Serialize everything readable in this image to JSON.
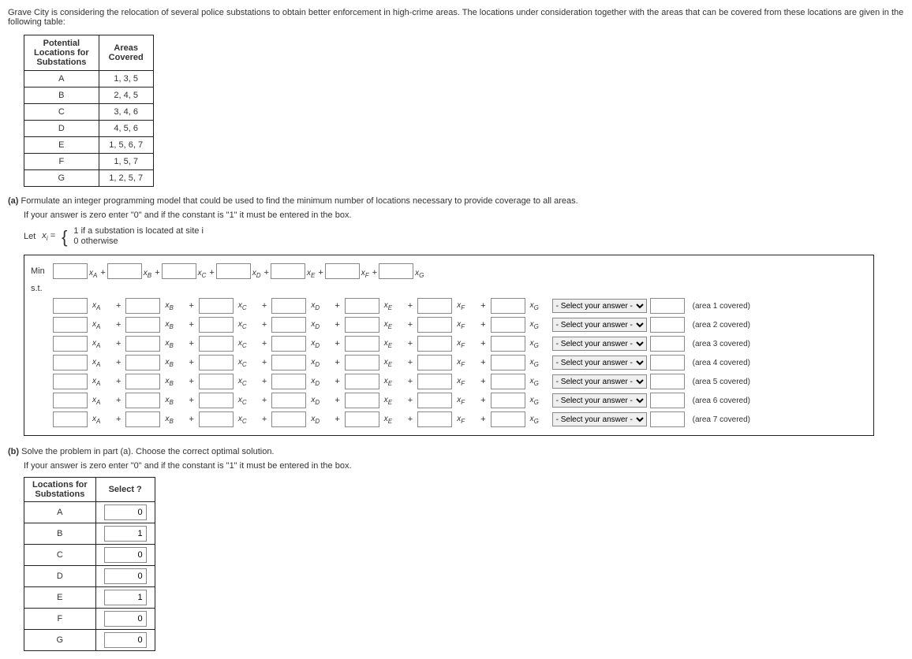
{
  "intro": "Grave City is considering the relocation of several police substations to obtain better enforcement in high-crime areas. The locations under consideration together with the areas that can be covered from these locations are given in the following table:",
  "table1": {
    "h1a": "Potential",
    "h1b": "Locations for",
    "h1c": "Substations",
    "h2a": "Areas",
    "h2b": "Covered",
    "rows": [
      {
        "loc": "A",
        "areas": "1, 3, 5"
      },
      {
        "loc": "B",
        "areas": "2, 4, 5"
      },
      {
        "loc": "C",
        "areas": "3, 4, 6"
      },
      {
        "loc": "D",
        "areas": "4, 5, 6"
      },
      {
        "loc": "E",
        "areas": "1, 5, 6, 7"
      },
      {
        "loc": "F",
        "areas": "1, 5, 7"
      },
      {
        "loc": "G",
        "areas": "1, 2, 5, 7"
      }
    ]
  },
  "part_a": {
    "label": "(a)",
    "text": "Formulate an integer programming model that could be used to find the minimum number of locations necessary to provide coverage to all areas.",
    "inst": "If your answer is zero enter \"0\" and if the constant is \"1\" it must be entered in the box.",
    "let": "Let",
    "xi": "xi =",
    "line1": "1 if a substation is located at site i",
    "line2": "0 otherwise"
  },
  "obj": {
    "min": "Min",
    "st": "s.t.",
    "vars": [
      "xA",
      "xB",
      "xC",
      "xD",
      "xE",
      "xF",
      "xG"
    ],
    "plus": "+",
    "select_placeholder": "- Select your answer -",
    "constraints": [
      "(area 1 covered)",
      "(area 2 covered)",
      "(area 3 covered)",
      "(area 4 covered)",
      "(area 5 covered)",
      "(area 6 covered)",
      "(area 7 covered)"
    ]
  },
  "part_b": {
    "label": "(b)",
    "text": "Solve the problem in part (a). Choose the correct optimal solution.",
    "inst": "If your answer is zero enter \"0\" and if the constant is \"1\" it must be entered in the box.",
    "h1a": "Locations for",
    "h1b": "Substations",
    "h2": "Select ?",
    "rows": [
      {
        "loc": "A",
        "val": "0"
      },
      {
        "loc": "B",
        "val": "1"
      },
      {
        "loc": "C",
        "val": "0"
      },
      {
        "loc": "D",
        "val": "0"
      },
      {
        "loc": "E",
        "val": "1"
      },
      {
        "loc": "F",
        "val": "0"
      },
      {
        "loc": "G",
        "val": "0"
      }
    ]
  }
}
